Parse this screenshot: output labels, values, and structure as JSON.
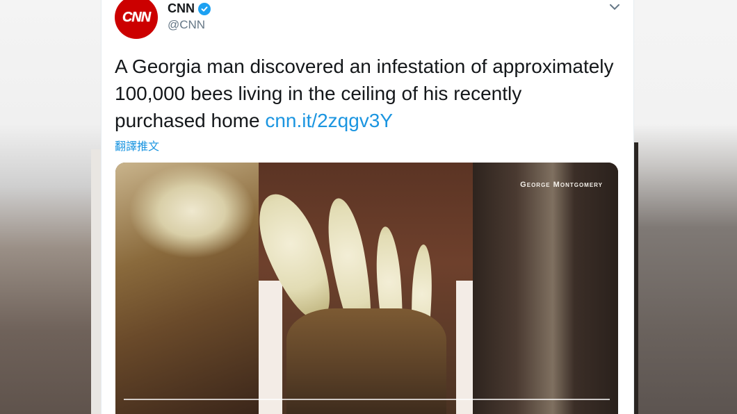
{
  "tweet": {
    "display_name": "CNN",
    "handle": "@CNN",
    "avatar_text": "CNN",
    "verified": true,
    "text_main": "A Georgia man discovered an infestation of approximately 100,000 bees living in the ceiling of his recently purchased home ",
    "link": "cnn.it/2zqgv3Y",
    "translate_label": "翻譯推文",
    "icons": [
      "verified-badge-icon",
      "chevron-down-icon"
    ]
  },
  "media": {
    "credit": "George Montgomery"
  },
  "colors": {
    "accent_blue": "#1da1f2",
    "link_blue": "#1b95e0",
    "cnn_red": "#cc0000"
  }
}
